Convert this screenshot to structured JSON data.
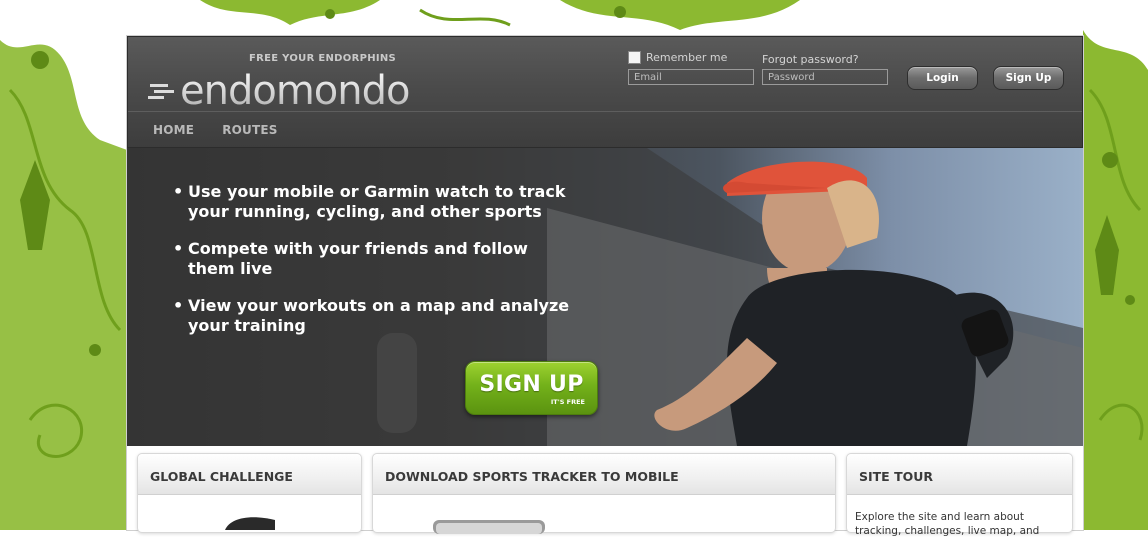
{
  "header": {
    "tagline": "FREE YOUR ENDORPHINS",
    "logo_text": "endomondo",
    "remember_label": "Remember me",
    "forgot_label": "Forgot password?",
    "email_placeholder": "Email",
    "password_placeholder": "Password",
    "login_label": "Login",
    "signup_label": "Sign Up"
  },
  "nav": {
    "items": [
      {
        "label": "HOME"
      },
      {
        "label": "ROUTES"
      }
    ]
  },
  "hero": {
    "bullets": [
      {
        "line1": "Use your mobile or Garmin watch to track",
        "line2": "your running, cycling, and other sports"
      },
      {
        "line1": "Compete with your friends and follow",
        "line2": "them live"
      },
      {
        "line1": "View your workouts on a map and analyze",
        "line2": "your training"
      }
    ],
    "signup_big": "SIGN UP",
    "signup_small": "IT'S FREE"
  },
  "panels": [
    {
      "title": "GLOBAL CHALLENGE"
    },
    {
      "title": "DOWNLOAD SPORTS TRACKER TO MOBILE"
    },
    {
      "title": "SITE TOUR",
      "text": "Explore the site and learn about tracking, challenges, live map, and"
    }
  ],
  "colors": {
    "accent_green": "#73b11a",
    "header_dark": "#4b4b4b",
    "background_green": "#7fb21e"
  },
  "icons": [
    "speed-lines-icon",
    "checkbox-icon",
    "bullet-icon"
  ]
}
